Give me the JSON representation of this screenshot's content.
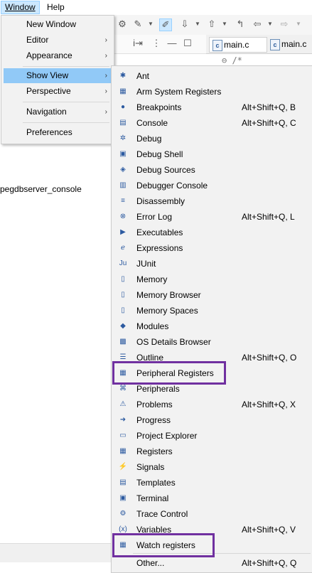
{
  "menubar": {
    "window": "Window",
    "help": "Help"
  },
  "editor": {
    "tab1": "main.c",
    "tab2": "main.c",
    "code_line": "⊖ /*"
  },
  "left_panel": {
    "console_text": "pegdbserver_console"
  },
  "window_menu": {
    "items": [
      {
        "label": "New Window",
        "submenu": false
      },
      {
        "label": "Editor",
        "submenu": true
      },
      {
        "label": "Appearance",
        "submenu": true
      },
      {
        "label": "Show View",
        "submenu": true
      },
      {
        "label": "Perspective",
        "submenu": true
      },
      {
        "label": "Navigation",
        "submenu": true
      },
      {
        "label": "Preferences",
        "submenu": false
      }
    ],
    "arrow": "›"
  },
  "show_view_menu": {
    "items": [
      {
        "label": "Ant",
        "shortcut": "",
        "icon": "ant-icon"
      },
      {
        "label": "Arm System Registers",
        "shortcut": "",
        "icon": "binary-registers-icon"
      },
      {
        "label": "Breakpoints",
        "shortcut": "Alt+Shift+Q, B",
        "icon": "breakpoints-icon"
      },
      {
        "label": "Console",
        "shortcut": "Alt+Shift+Q, C",
        "icon": "console-icon"
      },
      {
        "label": "Debug",
        "shortcut": "",
        "icon": "debug-icon"
      },
      {
        "label": "Debug Shell",
        "shortcut": "",
        "icon": "debug-shell-icon"
      },
      {
        "label": "Debug Sources",
        "shortcut": "",
        "icon": "debug-sources-icon"
      },
      {
        "label": "Debugger Console",
        "shortcut": "",
        "icon": "debugger-console-icon"
      },
      {
        "label": "Disassembly",
        "shortcut": "",
        "icon": "disassembly-icon"
      },
      {
        "label": "Error Log",
        "shortcut": "Alt+Shift+Q, L",
        "icon": "error-log-icon"
      },
      {
        "label": "Executables",
        "shortcut": "",
        "icon": "executables-icon"
      },
      {
        "label": "Expressions",
        "shortcut": "",
        "icon": "expressions-icon"
      },
      {
        "label": "JUnit",
        "shortcut": "",
        "icon": "junit-icon"
      },
      {
        "label": "Memory",
        "shortcut": "",
        "icon": "memory-icon"
      },
      {
        "label": "Memory Browser",
        "shortcut": "",
        "icon": "memory-browser-icon"
      },
      {
        "label": "Memory Spaces",
        "shortcut": "",
        "icon": "memory-spaces-icon"
      },
      {
        "label": "Modules",
        "shortcut": "",
        "icon": "modules-icon"
      },
      {
        "label": "OS Details Browser",
        "shortcut": "",
        "icon": "os-details-icon"
      },
      {
        "label": "Outline",
        "shortcut": "Alt+Shift+Q, O",
        "icon": "outline-icon"
      },
      {
        "label": "Peripheral Registers",
        "shortcut": "",
        "icon": "binary-registers-icon"
      },
      {
        "label": "Peripherals",
        "shortcut": "",
        "icon": "peripherals-icon"
      },
      {
        "label": "Problems",
        "shortcut": "Alt+Shift+Q, X",
        "icon": "problems-icon"
      },
      {
        "label": "Progress",
        "shortcut": "",
        "icon": "progress-icon"
      },
      {
        "label": "Project Explorer",
        "shortcut": "",
        "icon": "project-explorer-icon"
      },
      {
        "label": "Registers",
        "shortcut": "",
        "icon": "registers-icon"
      },
      {
        "label": "Signals",
        "shortcut": "",
        "icon": "signals-icon"
      },
      {
        "label": "Templates",
        "shortcut": "",
        "icon": "templates-icon"
      },
      {
        "label": "Terminal",
        "shortcut": "",
        "icon": "terminal-icon"
      },
      {
        "label": "Trace Control",
        "shortcut": "",
        "icon": "trace-control-icon"
      },
      {
        "label": "Variables",
        "shortcut": "Alt+Shift+Q, V",
        "icon": "variables-icon"
      },
      {
        "label": "Watch registers",
        "shortcut": "",
        "icon": "binary-registers-icon"
      },
      {
        "label": "Other...",
        "shortcut": "Alt+Shift+Q, Q",
        "icon": ""
      }
    ]
  },
  "colors": {
    "highlight_box": "#7030a0",
    "menu_selection": "#91c9f7",
    "menu_bg": "#f2f2f2"
  }
}
